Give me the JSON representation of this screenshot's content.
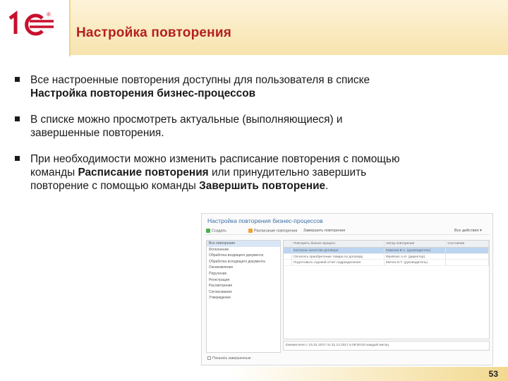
{
  "header": {
    "title": "Настройка повторения",
    "brand_color": "#c8102e",
    "accent_color": "#f7e3ad"
  },
  "bullets": [
    {
      "pre": "Все настроенные повторения доступны для пользователя в списке ",
      "b1": "Настройка повторения бизнес-процессов",
      "mid": "",
      "b2": "",
      "post": ""
    },
    {
      "pre": "В списке можно просмотреть актуальные (выполняющиеся) и завершенные повторения.",
      "b1": "",
      "mid": "",
      "b2": "",
      "post": ""
    },
    {
      "pre": "При необходимости можно изменить расписание повторения с помощью команды ",
      "b1": "Расписание повторения",
      "mid": " или принудительно завершить повторение с помощью команды ",
      "b2": "Завершить повторение",
      "post": "."
    }
  ],
  "screenshot": {
    "title": "Настройка повторения бизнес-процессов",
    "toolbar": [
      "Создать",
      "Расписание повторения",
      "Завершить повторение",
      "Все действия"
    ],
    "left_items": [
      "Все повторения",
      "Исполнение",
      "Обработка входящего документа",
      "Обработка исходящего документа",
      "Ознакомление",
      "Поручение",
      "Регистрация",
      "Рассмотрение",
      "Согласование",
      "Утверждение"
    ],
    "columns": [
      "",
      "Повторять бизнес-процесс",
      "Автор повторения",
      "Состояние"
    ],
    "rows": [
      [
        "",
        "Контроль качества договора",
        "Кавкаев В.А. (руководитель)",
        ""
      ],
      [
        "",
        "Оплатить приобретение товара по договору",
        "Фрейлих А.И. (директор)",
        ""
      ],
      [
        "",
        "Подготовить годовой отчет подразделения",
        "Митин И.Т. (руководитель)",
        ""
      ]
    ],
    "status_text": "Ежемесячно с 01.01.2017 по 31.12.2017 в 09:00:00 каждый месяц",
    "checkbox_label": "Показать завершенные"
  },
  "footer": {
    "page_number": "53"
  }
}
